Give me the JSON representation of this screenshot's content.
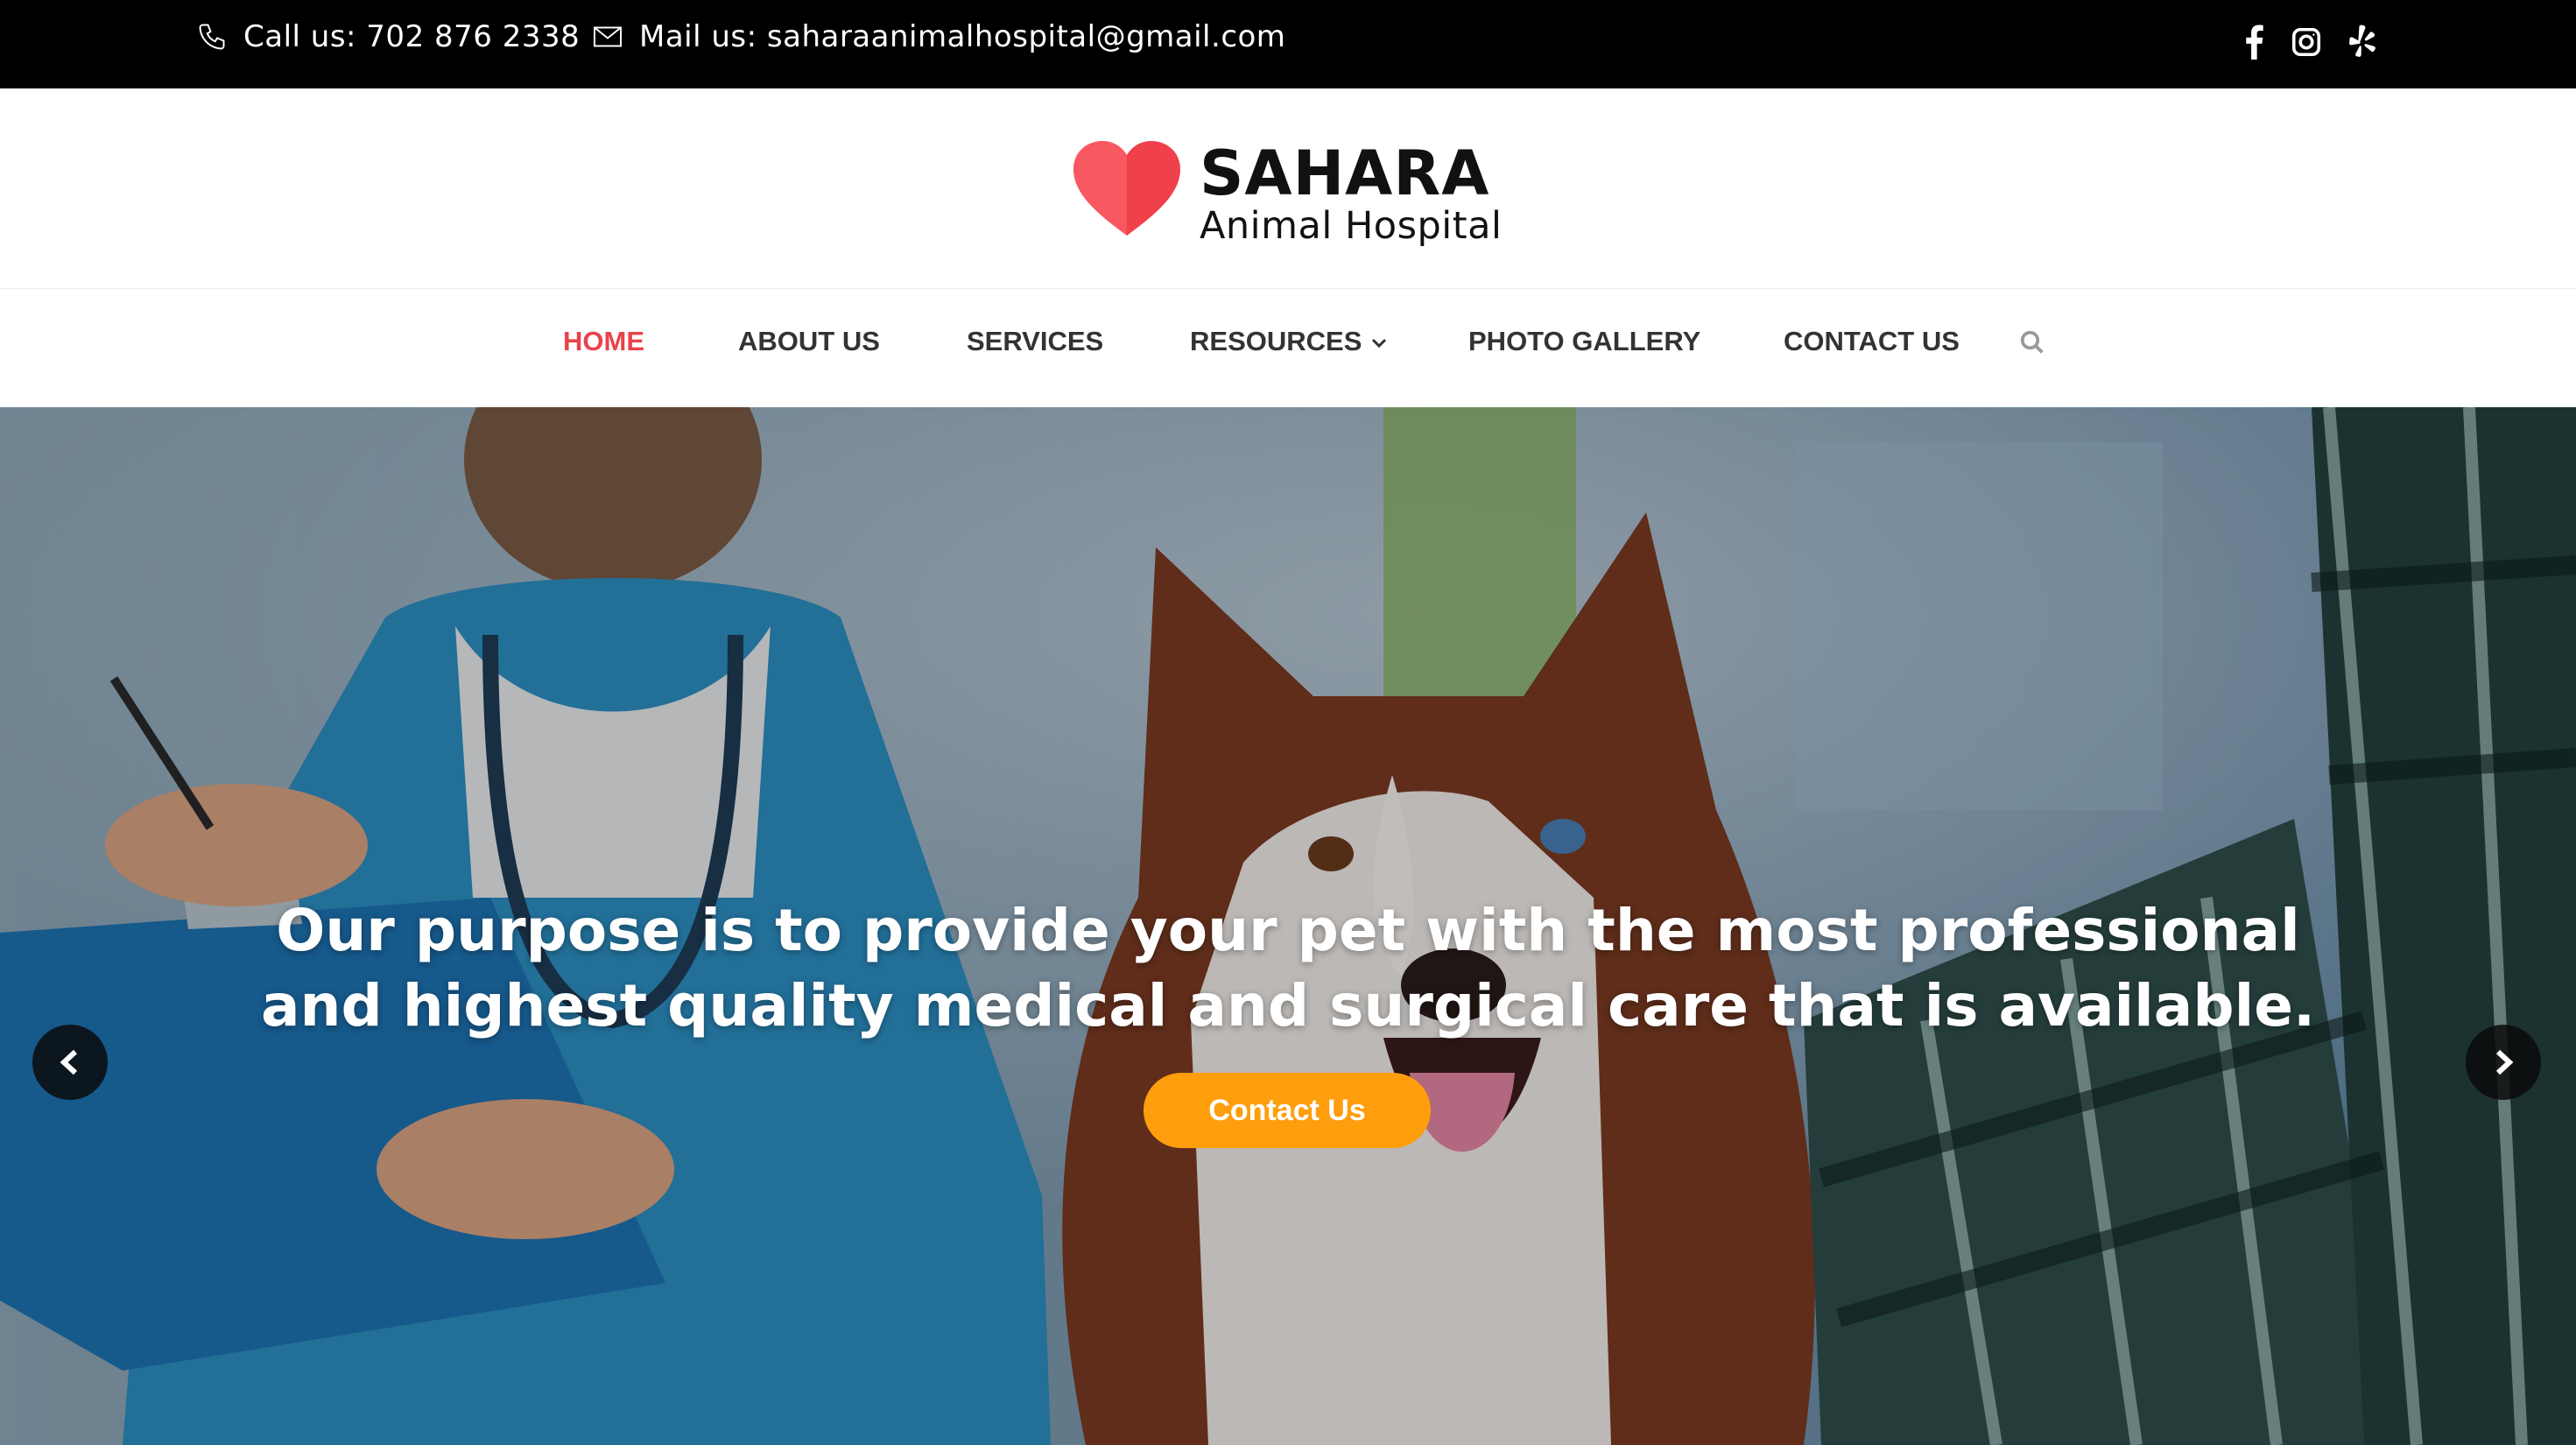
{
  "topbar": {
    "phone_text": "Call us: 702 876 2338",
    "mail_text": "Mail us: saharaanimalhospital@gmail.com",
    "phone_icon": "phone-icon",
    "mail_icon": "envelope-icon",
    "social": [
      "facebook-icon",
      "instagram-icon",
      "yelp-icon"
    ]
  },
  "logo": {
    "brand": "SAHARA",
    "subtitle": "Animal Hospital",
    "heart_color": "#f0404a"
  },
  "nav": {
    "items": [
      {
        "label": "HOME",
        "active": true
      },
      {
        "label": "ABOUT US",
        "active": false
      },
      {
        "label": "SERVICES",
        "active": false
      },
      {
        "label": "RESOURCES",
        "active": false,
        "has_dropdown": true
      },
      {
        "label": "PHOTO GALLERY",
        "active": false
      },
      {
        "label": "CONTACT US",
        "active": false
      }
    ],
    "search_icon": "search-icon",
    "active_color": "#e8434c"
  },
  "hero": {
    "headline_line1": "Our purpose is to provide your pet with the most professional",
    "headline_line2": "and highest quality medical and surgical care that is available.",
    "cta_label": "Contact Us",
    "cta_color": "#ff9e0d",
    "prev_icon": "chevron-left-icon",
    "next_icon": "chevron-right-icon"
  }
}
